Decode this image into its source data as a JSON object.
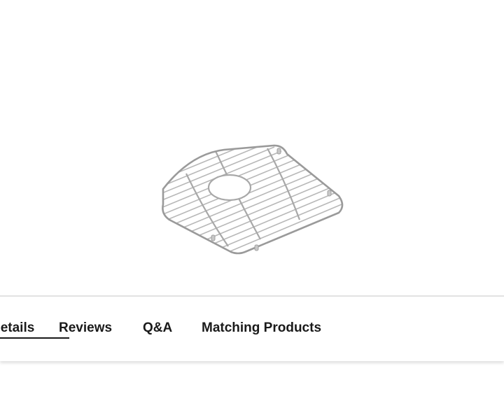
{
  "product": {
    "image_name": "sink-grid-rack-image"
  },
  "tabs": [
    {
      "label": "Details",
      "active": true
    },
    {
      "label": "Reviews",
      "active": false
    },
    {
      "label": "Q&A",
      "active": false
    },
    {
      "label": "Matching Products",
      "active": false
    }
  ]
}
